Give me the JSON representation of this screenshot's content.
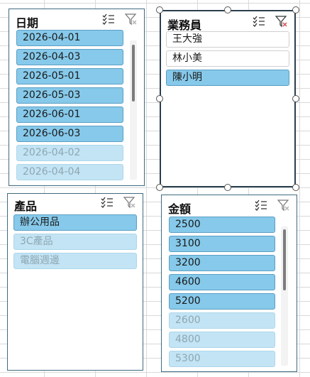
{
  "slicers": {
    "date": {
      "title": "日期",
      "items": [
        "2026-04-01",
        "2026-04-03",
        "2026-05-01",
        "2026-05-03",
        "2026-06-01",
        "2026-06-03",
        "2026-04-02",
        "2026-04-04"
      ],
      "item_states": [
        "selected",
        "selected",
        "selected",
        "selected",
        "selected",
        "selected",
        "no-data",
        "no-data"
      ]
    },
    "salesperson": {
      "title": "業務員",
      "items": [
        "王大強",
        "林小美",
        "陳小明"
      ],
      "item_states": [
        "unselected",
        "unselected",
        "selected"
      ]
    },
    "product": {
      "title": "產品",
      "items": [
        "辦公用品",
        "3C產品",
        "電腦週邊"
      ],
      "item_states": [
        "selected",
        "no-data",
        "no-data"
      ]
    },
    "amount": {
      "title": "金額",
      "items": [
        "2500",
        "3100",
        "3200",
        "4600",
        "5200",
        "2600",
        "4800",
        "5300"
      ],
      "item_states": [
        "selected",
        "selected",
        "selected",
        "selected",
        "selected",
        "no-data",
        "no-data",
        "no-data"
      ]
    }
  },
  "icons": {
    "multi_select": "multi-select-icon",
    "clear_filter": "clear-filter-icon"
  },
  "colors": {
    "selected_item": "#86c9ea",
    "nodata_item": "#c2e4f4",
    "unselected_item": "#ffffff",
    "slicer_border": "#3f6b80",
    "clear_filter_x": "#d9534f"
  }
}
